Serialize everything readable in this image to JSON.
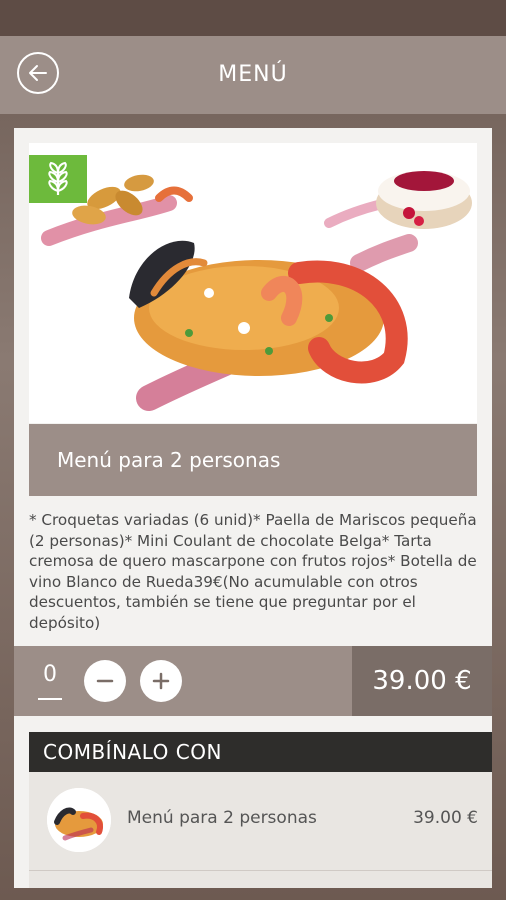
{
  "app_bar": {
    "title": "MENÚ"
  },
  "product": {
    "name": "Menú para 2 personas",
    "description": "* Croquetas variadas (6 unid)* Paella de Mariscos pequeña (2 personas)* Mini Coulant de chocolate Belga* Tarta cremosa de quero mascarpone con frutos rojos* Botella de vino Blanco de Rueda39€(No acumulable con otros descuentos, también se tiene que preguntar por el depósito)",
    "quantity": "0",
    "price": "39.00 €"
  },
  "combo": {
    "heading": "COMBÍNALO CON",
    "items": [
      {
        "name": "Menú para 2 personas",
        "price": "39.00 €"
      }
    ]
  },
  "colors": {
    "brand": "#9c8e88",
    "price_bg": "#7a6d67",
    "veg_badge": "#6dba3c",
    "combo_header": "#2e2d2b"
  },
  "icons": [
    "back-arrow-icon",
    "wheat-icon",
    "minus-icon",
    "plus-icon"
  ]
}
